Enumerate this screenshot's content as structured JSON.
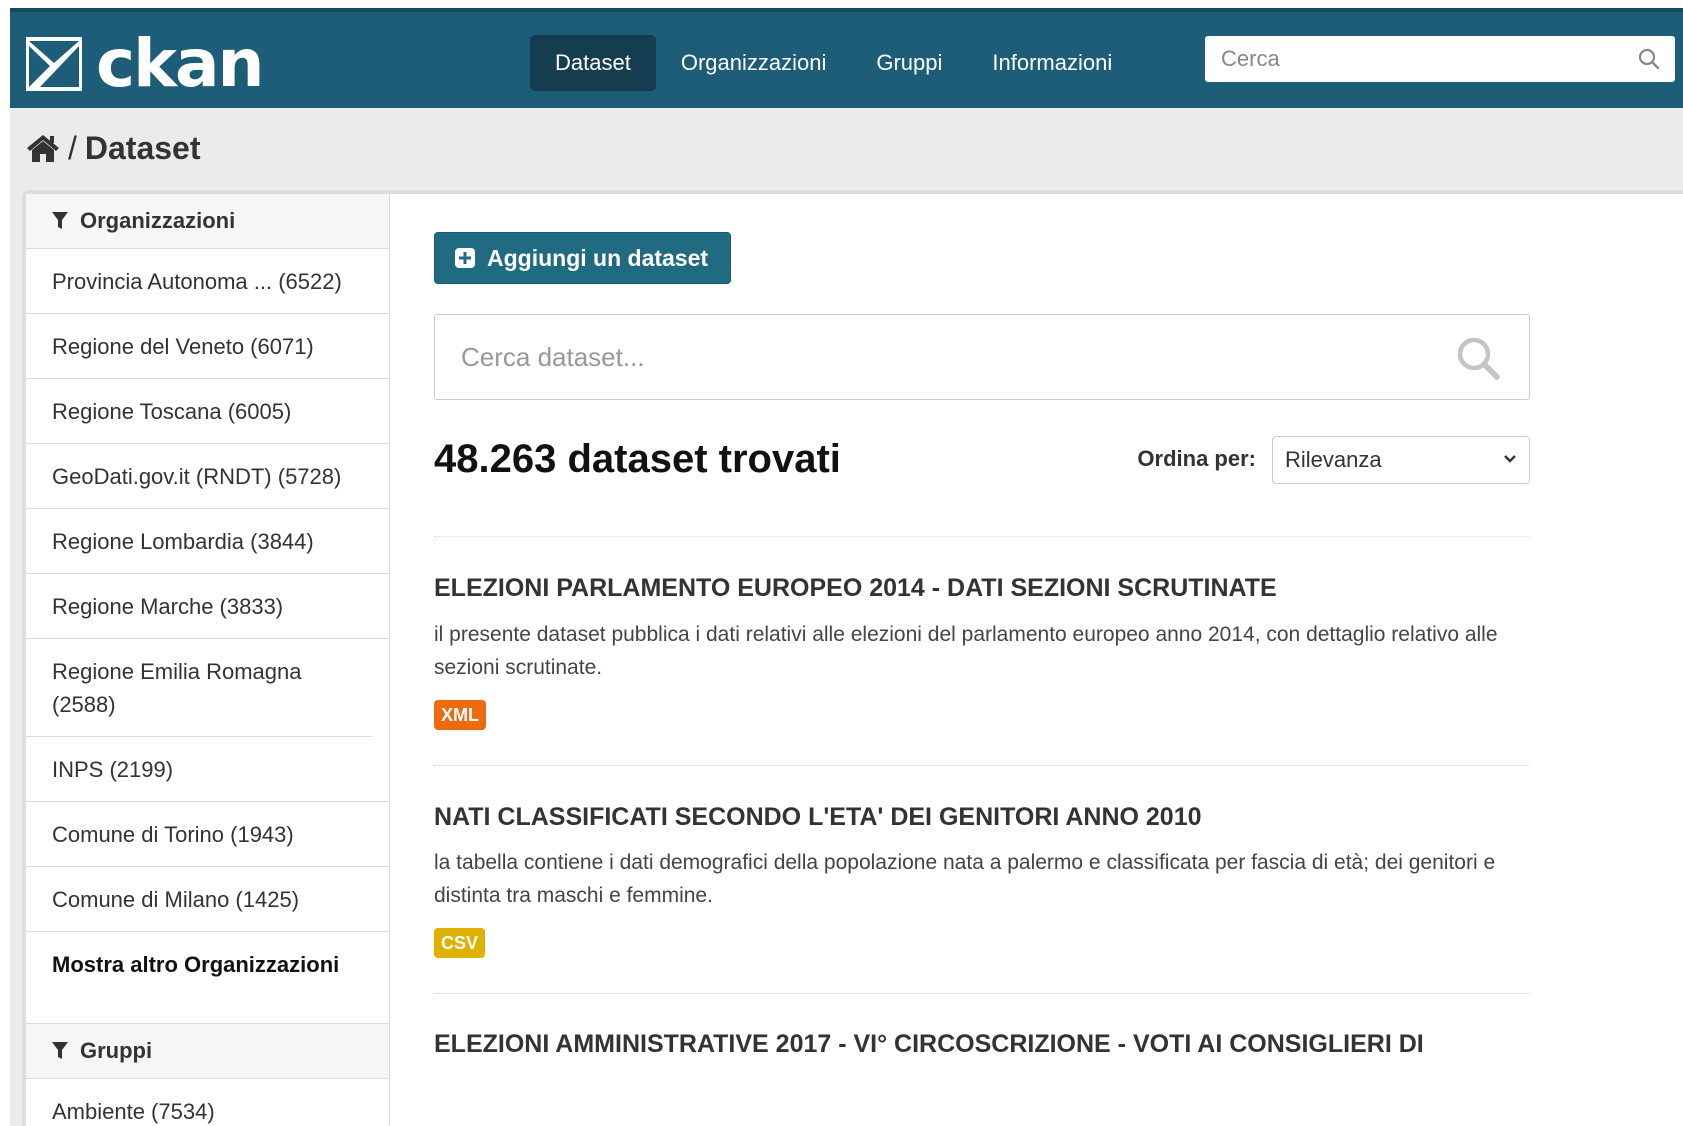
{
  "header": {
    "logo_text": "ckan",
    "nav": [
      {
        "label": "Dataset",
        "active": true
      },
      {
        "label": "Organizzazioni",
        "active": false
      },
      {
        "label": "Gruppi",
        "active": false
      },
      {
        "label": "Informazioni",
        "active": false
      }
    ],
    "search_placeholder": "Cerca",
    "bg_color": "#1e5d78"
  },
  "breadcrumb": {
    "home_icon": "home-icon",
    "separator": "/",
    "current": "Dataset"
  },
  "sidebar": {
    "organizations": {
      "title": "Organizzazioni",
      "icon": "filter-icon",
      "items": [
        "Provincia Autonoma ... (6522)",
        "Regione del Veneto (6071)",
        "Regione Toscana (6005)",
        "GeoDati.gov.it (RNDT) (5728)",
        "Regione Lombardia (3844)",
        "Regione Marche (3833)",
        "Regione Emilia Romagna (2588)",
        "INPS (2199)",
        "Comune di Torino (1943)",
        "Comune di Milano (1425)"
      ],
      "more_label": "Mostra altro Organizzazioni"
    },
    "groups": {
      "title": "Gruppi",
      "icon": "filter-icon",
      "items": [
        "Ambiente (7534)"
      ]
    }
  },
  "main": {
    "add_button": "Aggiungi un dataset",
    "search_placeholder": "Cerca dataset...",
    "count_text": "48.263 dataset trovati",
    "sort_label": "Ordina per:",
    "sort_value": "Rilevanza",
    "datasets": [
      {
        "title": "ELEZIONI PARLAMENTO EUROPEO 2014 - DATI SEZIONI SCRUTINATE",
        "notes": "il presente dataset pubblica i dati relativi alle elezioni del parlamento europeo anno 2014, con dettaglio relativo alle sezioni scrutinate.",
        "format": "XML",
        "format_color": "#ec6b0e"
      },
      {
        "title": "NATI CLASSIFICATI SECONDO L'ETA' DEI GENITORI ANNO 2010",
        "notes": "la tabella contiene i dati demografici della popolazione nata a palermo e classificata per fascia di età; dei genitori e distinta tra maschi e femmine.",
        "format": "CSV",
        "format_color": "#dfb100"
      },
      {
        "title": "ELEZIONI AMMINISTRATIVE 2017 - VI° CIRCOSCRIZIONE - VOTI AI CONSIGLIERI DI"
      }
    ]
  }
}
